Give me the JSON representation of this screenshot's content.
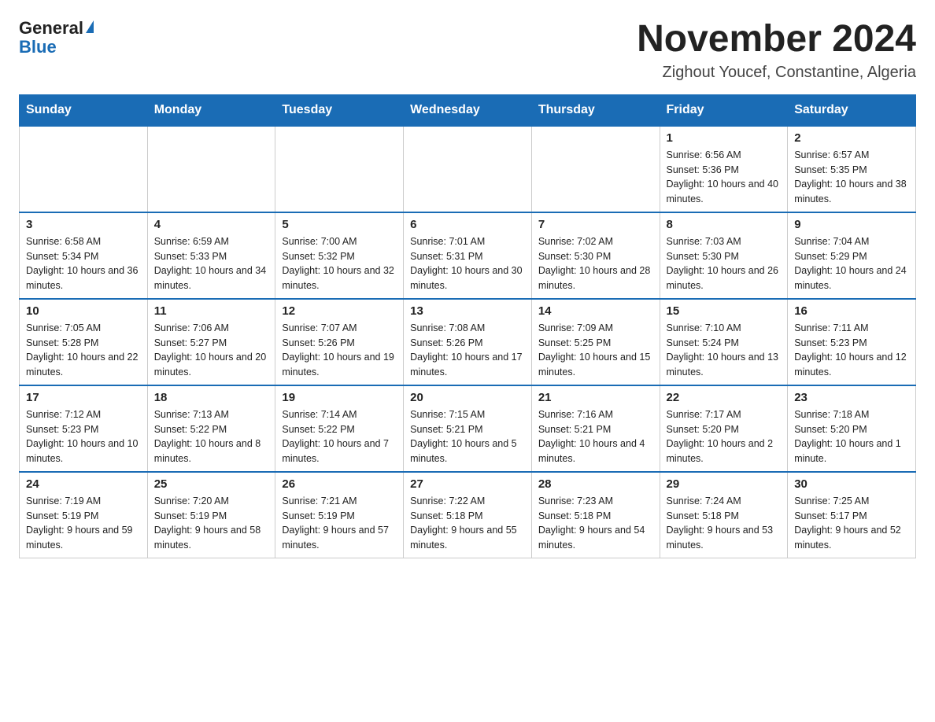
{
  "logo": {
    "general": "General",
    "blue": "Blue"
  },
  "header": {
    "month_year": "November 2024",
    "location": "Zighout Youcef, Constantine, Algeria"
  },
  "days_of_week": [
    "Sunday",
    "Monday",
    "Tuesday",
    "Wednesday",
    "Thursday",
    "Friday",
    "Saturday"
  ],
  "weeks": [
    [
      {
        "day": "",
        "sunrise": "",
        "sunset": "",
        "daylight": ""
      },
      {
        "day": "",
        "sunrise": "",
        "sunset": "",
        "daylight": ""
      },
      {
        "day": "",
        "sunrise": "",
        "sunset": "",
        "daylight": ""
      },
      {
        "day": "",
        "sunrise": "",
        "sunset": "",
        "daylight": ""
      },
      {
        "day": "",
        "sunrise": "",
        "sunset": "",
        "daylight": ""
      },
      {
        "day": "1",
        "sunrise": "Sunrise: 6:56 AM",
        "sunset": "Sunset: 5:36 PM",
        "daylight": "Daylight: 10 hours and 40 minutes."
      },
      {
        "day": "2",
        "sunrise": "Sunrise: 6:57 AM",
        "sunset": "Sunset: 5:35 PM",
        "daylight": "Daylight: 10 hours and 38 minutes."
      }
    ],
    [
      {
        "day": "3",
        "sunrise": "Sunrise: 6:58 AM",
        "sunset": "Sunset: 5:34 PM",
        "daylight": "Daylight: 10 hours and 36 minutes."
      },
      {
        "day": "4",
        "sunrise": "Sunrise: 6:59 AM",
        "sunset": "Sunset: 5:33 PM",
        "daylight": "Daylight: 10 hours and 34 minutes."
      },
      {
        "day": "5",
        "sunrise": "Sunrise: 7:00 AM",
        "sunset": "Sunset: 5:32 PM",
        "daylight": "Daylight: 10 hours and 32 minutes."
      },
      {
        "day": "6",
        "sunrise": "Sunrise: 7:01 AM",
        "sunset": "Sunset: 5:31 PM",
        "daylight": "Daylight: 10 hours and 30 minutes."
      },
      {
        "day": "7",
        "sunrise": "Sunrise: 7:02 AM",
        "sunset": "Sunset: 5:30 PM",
        "daylight": "Daylight: 10 hours and 28 minutes."
      },
      {
        "day": "8",
        "sunrise": "Sunrise: 7:03 AM",
        "sunset": "Sunset: 5:30 PM",
        "daylight": "Daylight: 10 hours and 26 minutes."
      },
      {
        "day": "9",
        "sunrise": "Sunrise: 7:04 AM",
        "sunset": "Sunset: 5:29 PM",
        "daylight": "Daylight: 10 hours and 24 minutes."
      }
    ],
    [
      {
        "day": "10",
        "sunrise": "Sunrise: 7:05 AM",
        "sunset": "Sunset: 5:28 PM",
        "daylight": "Daylight: 10 hours and 22 minutes."
      },
      {
        "day": "11",
        "sunrise": "Sunrise: 7:06 AM",
        "sunset": "Sunset: 5:27 PM",
        "daylight": "Daylight: 10 hours and 20 minutes."
      },
      {
        "day": "12",
        "sunrise": "Sunrise: 7:07 AM",
        "sunset": "Sunset: 5:26 PM",
        "daylight": "Daylight: 10 hours and 19 minutes."
      },
      {
        "day": "13",
        "sunrise": "Sunrise: 7:08 AM",
        "sunset": "Sunset: 5:26 PM",
        "daylight": "Daylight: 10 hours and 17 minutes."
      },
      {
        "day": "14",
        "sunrise": "Sunrise: 7:09 AM",
        "sunset": "Sunset: 5:25 PM",
        "daylight": "Daylight: 10 hours and 15 minutes."
      },
      {
        "day": "15",
        "sunrise": "Sunrise: 7:10 AM",
        "sunset": "Sunset: 5:24 PM",
        "daylight": "Daylight: 10 hours and 13 minutes."
      },
      {
        "day": "16",
        "sunrise": "Sunrise: 7:11 AM",
        "sunset": "Sunset: 5:23 PM",
        "daylight": "Daylight: 10 hours and 12 minutes."
      }
    ],
    [
      {
        "day": "17",
        "sunrise": "Sunrise: 7:12 AM",
        "sunset": "Sunset: 5:23 PM",
        "daylight": "Daylight: 10 hours and 10 minutes."
      },
      {
        "day": "18",
        "sunrise": "Sunrise: 7:13 AM",
        "sunset": "Sunset: 5:22 PM",
        "daylight": "Daylight: 10 hours and 8 minutes."
      },
      {
        "day": "19",
        "sunrise": "Sunrise: 7:14 AM",
        "sunset": "Sunset: 5:22 PM",
        "daylight": "Daylight: 10 hours and 7 minutes."
      },
      {
        "day": "20",
        "sunrise": "Sunrise: 7:15 AM",
        "sunset": "Sunset: 5:21 PM",
        "daylight": "Daylight: 10 hours and 5 minutes."
      },
      {
        "day": "21",
        "sunrise": "Sunrise: 7:16 AM",
        "sunset": "Sunset: 5:21 PM",
        "daylight": "Daylight: 10 hours and 4 minutes."
      },
      {
        "day": "22",
        "sunrise": "Sunrise: 7:17 AM",
        "sunset": "Sunset: 5:20 PM",
        "daylight": "Daylight: 10 hours and 2 minutes."
      },
      {
        "day": "23",
        "sunrise": "Sunrise: 7:18 AM",
        "sunset": "Sunset: 5:20 PM",
        "daylight": "Daylight: 10 hours and 1 minute."
      }
    ],
    [
      {
        "day": "24",
        "sunrise": "Sunrise: 7:19 AM",
        "sunset": "Sunset: 5:19 PM",
        "daylight": "Daylight: 9 hours and 59 minutes."
      },
      {
        "day": "25",
        "sunrise": "Sunrise: 7:20 AM",
        "sunset": "Sunset: 5:19 PM",
        "daylight": "Daylight: 9 hours and 58 minutes."
      },
      {
        "day": "26",
        "sunrise": "Sunrise: 7:21 AM",
        "sunset": "Sunset: 5:19 PM",
        "daylight": "Daylight: 9 hours and 57 minutes."
      },
      {
        "day": "27",
        "sunrise": "Sunrise: 7:22 AM",
        "sunset": "Sunset: 5:18 PM",
        "daylight": "Daylight: 9 hours and 55 minutes."
      },
      {
        "day": "28",
        "sunrise": "Sunrise: 7:23 AM",
        "sunset": "Sunset: 5:18 PM",
        "daylight": "Daylight: 9 hours and 54 minutes."
      },
      {
        "day": "29",
        "sunrise": "Sunrise: 7:24 AM",
        "sunset": "Sunset: 5:18 PM",
        "daylight": "Daylight: 9 hours and 53 minutes."
      },
      {
        "day": "30",
        "sunrise": "Sunrise: 7:25 AM",
        "sunset": "Sunset: 5:17 PM",
        "daylight": "Daylight: 9 hours and 52 minutes."
      }
    ]
  ]
}
